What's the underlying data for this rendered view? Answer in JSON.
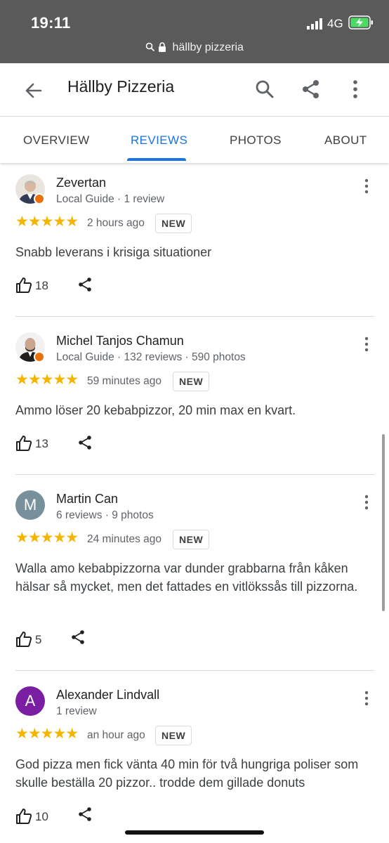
{
  "status_bar": {
    "time": "19:11",
    "network": "4G",
    "url": "hällby pizzeria"
  },
  "app_bar": {
    "title": "Hällby Pizzeria",
    "icons": [
      "back-arrow-icon",
      "search-icon",
      "share-icon",
      "more-vert-icon"
    ]
  },
  "tabs": [
    {
      "label": "OVERVIEW",
      "active": false
    },
    {
      "label": "REVIEWS",
      "active": true
    },
    {
      "label": "PHOTOS",
      "active": false
    },
    {
      "label": "ABOUT",
      "active": false
    }
  ],
  "accent_color": "#1a73e8",
  "star_color": "#f4b400",
  "reviews": [
    {
      "name": "Zevertan",
      "meta": "Local Guide · 1 review",
      "stars": 5,
      "time_ago": "2 hours ago",
      "badge": "NEW",
      "text": "Snabb leverans i krisiga situationer",
      "likes": "18",
      "avatar": "photo"
    },
    {
      "name": "Michel Tanjos Chamun",
      "meta": "Local Guide · 132 reviews · 590 photos",
      "stars": 5,
      "time_ago": "59 minutes ago",
      "badge": "NEW",
      "text": "Ammo löser 20 kebabpizzor, 20 min max en kvart.",
      "likes": "13",
      "avatar": "photo"
    },
    {
      "name": "Martin Can",
      "meta": "6 reviews · 9 photos",
      "stars": 5,
      "time_ago": "24 minutes ago",
      "badge": "NEW",
      "text": "Walla amo kebabpizzorna var dunder grabbarna från kåken hälsar så mycket, men det fattades en vitlökssås till pizzorna.",
      "likes": "5",
      "avatar": "M",
      "avatar_color": "#78909c"
    },
    {
      "name": "Alexander Lindvall",
      "meta": "1 review",
      "stars": 5,
      "time_ago": "an hour ago",
      "badge": "NEW",
      "text": "God pizza men fick vänta 40 min för två hungriga poliser som skulle beställa 20 pizzor.. trodde dem gillade donuts",
      "likes": "10",
      "avatar": "A",
      "avatar_color": "#7b1fa2"
    }
  ]
}
